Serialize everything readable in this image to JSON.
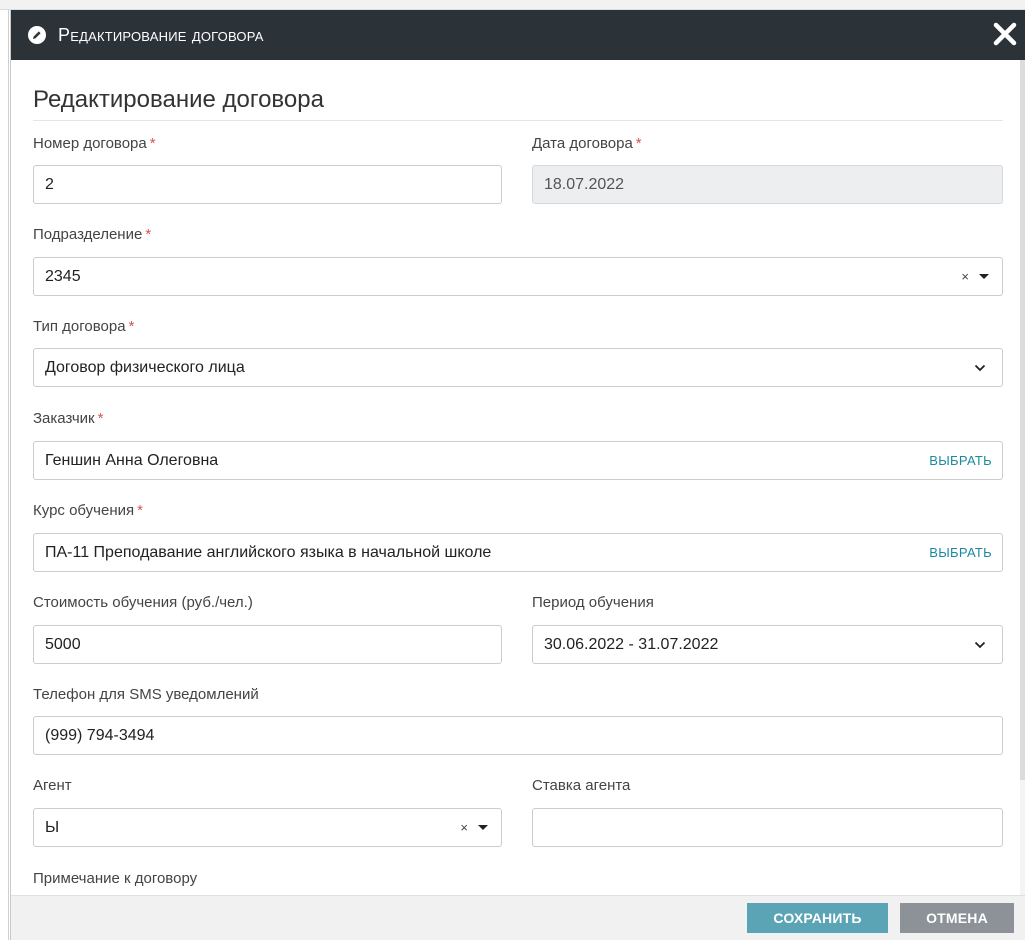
{
  "header": {
    "title": "Редактирование договора",
    "icon": "pencil-icon"
  },
  "form": {
    "title": "Редактирование договора",
    "required_mark": "*",
    "contract_number": {
      "label": "Номер договора",
      "value": "2"
    },
    "contract_date": {
      "label": "Дата договора",
      "value": "18.07.2022"
    },
    "department": {
      "label": "Подразделение",
      "value": "2345",
      "clear": "×"
    },
    "contract_type": {
      "label": "Тип договора",
      "value": "Договор физического лица"
    },
    "customer": {
      "label": "Заказчик",
      "value": "Геншин Анна Олеговна",
      "action": "ВЫБРАТЬ"
    },
    "course": {
      "label": "Курс обучения",
      "value": "ПА-11 Преподавание английского языка в начальной школе",
      "action": "ВЫБРАТЬ"
    },
    "cost": {
      "label": "Стоимость обучения (руб./чел.)",
      "value": "5000"
    },
    "period": {
      "label": "Период обучения",
      "value": "30.06.2022 - 31.07.2022"
    },
    "phone": {
      "label": "Телефон для SMS уведомлений",
      "value": "(999) 794-3494"
    },
    "agent": {
      "label": "Агент",
      "value": "Ы",
      "clear": "×"
    },
    "agent_rate": {
      "label": "Ставка агента",
      "value": ""
    },
    "note": {
      "label": "Примечание к договору"
    }
  },
  "footer": {
    "save_label": "СОХРАНИТЬ",
    "cancel_label": "ОТМЕНА"
  },
  "colors": {
    "header_bg": "#2c3338",
    "accent": "#1b8aa0",
    "save_bg": "#5ba4b5",
    "cancel_bg": "#8c9297",
    "required": "#d9534f"
  }
}
